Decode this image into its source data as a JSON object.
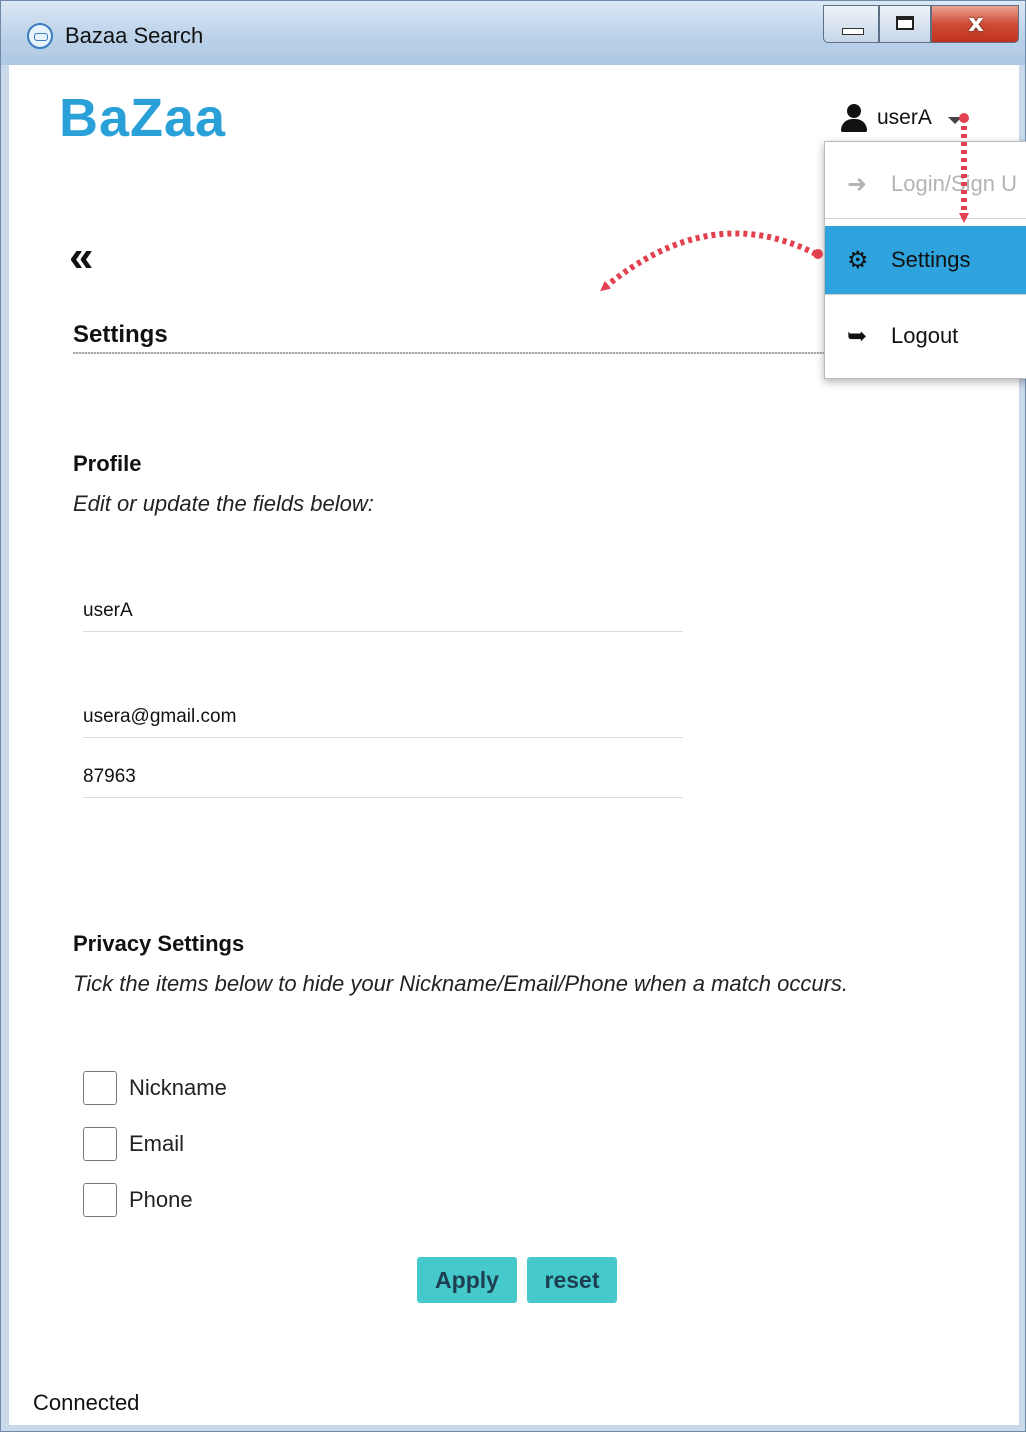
{
  "window": {
    "title": "Bazaa Search",
    "close_glyph": "x"
  },
  "header": {
    "logo": "BaZaa",
    "user_name": "userA"
  },
  "dropdown": {
    "items": [
      {
        "label": "Login/Sign U",
        "icon": "sign-in-icon",
        "state": "disabled"
      },
      {
        "label": "Settings",
        "icon": "gears-icon",
        "state": "highlighted"
      },
      {
        "label": "Logout",
        "icon": "sign-out-icon",
        "state": "normal"
      }
    ]
  },
  "page": {
    "back_glyph": "«",
    "heading": "Settings"
  },
  "profile": {
    "heading": "Profile",
    "subtitle": "Edit or update the fields below:",
    "nickname": "userA",
    "email": "usera@gmail.com",
    "phone": "87963"
  },
  "privacy": {
    "heading": "Privacy Settings",
    "subtitle": "Tick the items below to hide your Nickname/Email/Phone when a match occurs.",
    "options": [
      {
        "label": "Nickname",
        "checked": false
      },
      {
        "label": "Email",
        "checked": false
      },
      {
        "label": "Phone",
        "checked": false
      }
    ]
  },
  "actions": {
    "apply": "Apply",
    "reset": "reset"
  },
  "status": "Connected",
  "colors": {
    "brand": "#2aa0d8",
    "highlight": "#2ea3dd",
    "button": "#45c9cb",
    "annotation": "#e2414f"
  }
}
